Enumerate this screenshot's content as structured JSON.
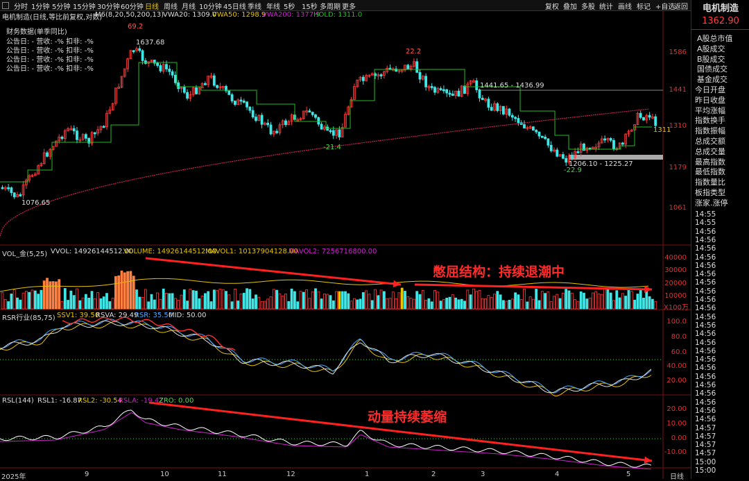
{
  "toolbar": {
    "timeframes": [
      "分时",
      "1分钟",
      "5分钟",
      "15分钟",
      "30分钟",
      "60分钟",
      "日线",
      "周线",
      "月线",
      "10分钟",
      "45日线",
      "季线",
      "年线",
      "5秒",
      "15秒",
      "多周期",
      "更多"
    ],
    "active_timeframe": "日线",
    "right_buttons": [
      "复权",
      "叠加",
      "多股",
      "统计",
      "画线",
      "标记",
      "+自选",
      "返回"
    ]
  },
  "right_panel": {
    "stock_name": "电机制造",
    "last_price": "1362.90",
    "menu_items": [
      "A股总市值",
      "A股成交",
      "B股成交",
      "国债成交",
      "基金成交",
      "今日开盘",
      "昨日收盘",
      "平均涨幅",
      "指数换手",
      "指数振幅",
      "总成交额",
      "总成交量",
      "最高指数",
      "最低指数",
      "指数量比",
      "板指类型",
      "涨家.涨停"
    ],
    "ticks": [
      "14:55",
      "14:55",
      "14:56",
      "14:56",
      "14:56",
      "14:56",
      "14:56",
      "14:56",
      "14:56",
      "14:56",
      "14:56",
      "14:56",
      "14:56",
      "14:56",
      "14:56",
      "14:56",
      "14:56",
      "14:56",
      "14:56",
      "14:56",
      "14:56",
      "14:56",
      "14:56",
      "14:56",
      "14:56",
      "14:57",
      "14:57",
      "14:57",
      "14:57",
      "15:00",
      "15:00"
    ]
  },
  "main_chart": {
    "title": "电机制造(日线,等比前复权,对数)",
    "indicator": "M6(8,20,50,200,13)",
    "vwa20": "VWA20: 1309.0",
    "vwa50": "VWA50: 1298.9",
    "vwa200": "VWA200: 1377.9",
    "hold": "HOLD: 1311.0",
    "financial": {
      "header": "财务数据(单季同比)",
      "rows": [
        "公告日: -    营收: -%    扣非: -%",
        "公告日: -    营收: -%    扣非: -%",
        "公告日: -    营收: -%    扣非: -%",
        "公告日: -    营收: -%    扣非: -%"
      ]
    },
    "y_ticks": [
      "1586",
      "1441",
      "1310",
      "1179",
      "1061"
    ],
    "annotations": {
      "high": "1637.68",
      "low": "1076.65",
      "mid_high": "22.2",
      "peak_rsr": "69.2",
      "mark_low1": "-21.4",
      "mark_low2": "-22.9",
      "range_high": "1441.65 - 1436.99",
      "range_low": "1206.10 - 1225.27",
      "last_hold": "1311"
    }
  },
  "volume_panel": {
    "title": "VOL_金(5,25)",
    "vvol": "VVOL: 14926144512.00",
    "volume": "VOLUME: 14926144512.00",
    "mavol1": "MAVOL1: 10137904128.00",
    "mavol2": "MAVOL2: 7256716800.00",
    "y_ticks": [
      "40000",
      "30000",
      "20000",
      "10000"
    ],
    "unit": "X100万",
    "annotation": "憋屈结构：持续退潮中"
  },
  "rsr_panel": {
    "title": "RSR行业(85,75)",
    "ssv1": "SSV1: 39.50",
    "rsva": "RSVA: 29.49",
    "rsr": "RSR: 35.50",
    "mid": "MID: 50.00",
    "y_ticks": [
      "100.0",
      "80.0",
      "60.0",
      "40.00",
      "20.00"
    ]
  },
  "rsl_panel": {
    "title": "RSL(144)",
    "rsl1": "RSL1: -16.87",
    "rsl2": "RSL2: -30.54",
    "rsla": "RSLA: -19.42",
    "zro": "ZRO: 0.00",
    "y_ticks": [
      "20.00",
      "10.00",
      "0.00",
      "-10.00"
    ],
    "annotation": "动量持续萎缩"
  },
  "x_axis": {
    "labels": [
      "2025年",
      "9",
      "10",
      "11",
      "12",
      "1",
      "2",
      "3",
      "4",
      "5"
    ],
    "period": "日线"
  },
  "colors": {
    "up": "#ff3b3b",
    "down": "#3fe6e6",
    "vwa20": "#20c020",
    "vwa50": "#e6c400",
    "vwa200": "#d020d0",
    "annot": "#ff2a2a"
  }
}
